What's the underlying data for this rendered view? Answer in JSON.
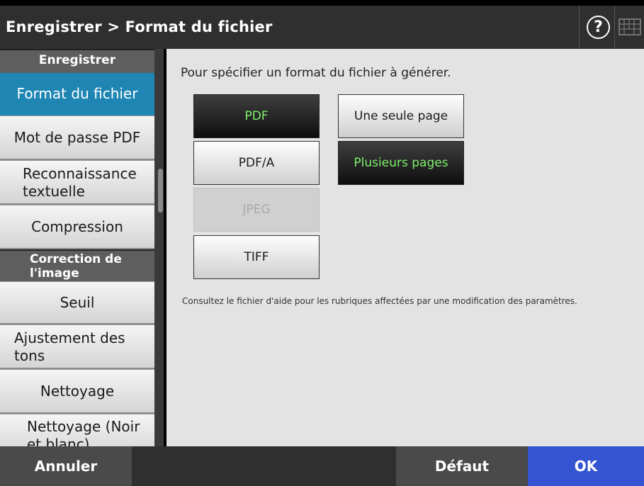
{
  "header": {
    "title": "Enregistrer > Format du fichier",
    "help_symbol": "?",
    "help_icon": "help-circle-icon",
    "keyboard_icon": "keyboard-icon"
  },
  "sidebar": {
    "sections": [
      {
        "header": "Enregistrer",
        "items": [
          {
            "label": "Format du fichier",
            "active": true
          },
          {
            "label": "Mot de passe PDF",
            "active": false
          },
          {
            "label": "Reconnaissance textuelle",
            "active": false
          },
          {
            "label": "Compression",
            "active": false
          }
        ]
      },
      {
        "header": "Correction de l'image",
        "items": [
          {
            "label": "Seuil",
            "active": false
          },
          {
            "label": "Ajustement des tons",
            "active": false
          },
          {
            "label": "Nettoyage",
            "active": false
          },
          {
            "label": "Nettoyage (Noir et blanc)",
            "active": false
          }
        ]
      }
    ]
  },
  "main": {
    "instruction": "Pour spécifier un format du fichier à générer.",
    "formats": [
      {
        "label": "PDF",
        "state": "selected"
      },
      {
        "label": "PDF/A",
        "state": "normal"
      },
      {
        "label": "JPEG",
        "state": "disabled"
      },
      {
        "label": "TIFF",
        "state": "normal"
      }
    ],
    "page_options": [
      {
        "label": "Une seule page",
        "state": "normal"
      },
      {
        "label": "Plusieurs pages",
        "state": "selected"
      }
    ],
    "note": "Consultez le fichier d'aide pour les rubriques affectées par une modification des paramètres."
  },
  "footer": {
    "cancel_label": "Annuler",
    "default_label": "Défaut",
    "ok_label": "OK"
  },
  "colors": {
    "active_sidebar": "#1f86b4",
    "selected_text": "#7df06a",
    "ok_button": "#3554d1",
    "header_bg": "#2f2f2f"
  }
}
